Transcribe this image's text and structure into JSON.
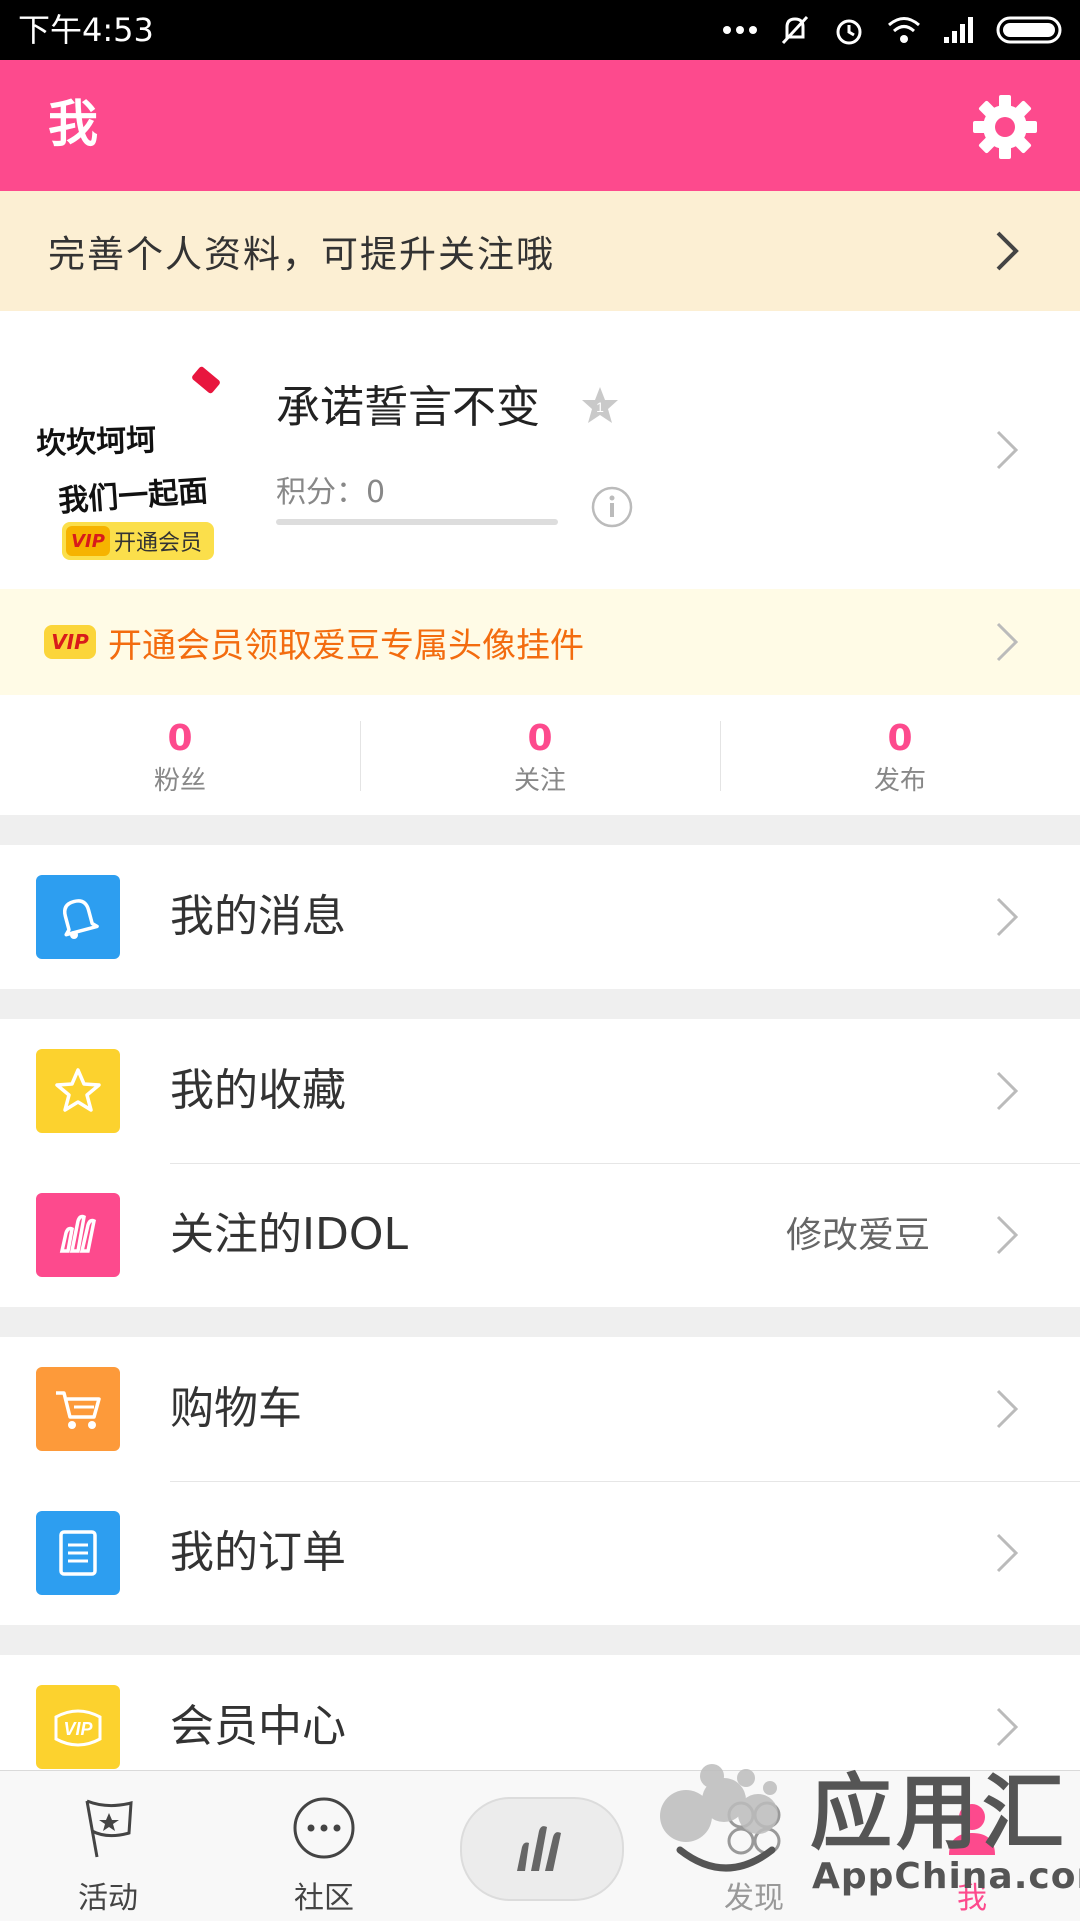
{
  "status_bar": {
    "time": "下午4:53"
  },
  "app_bar": {
    "title": "我"
  },
  "profile_prompt": {
    "text": "完善个人资料，可提升关注哦"
  },
  "profile": {
    "avatar_text_line1": "坎坎坷坷",
    "avatar_text_line2": "我们一起面",
    "vip_badge_mark": "VIP",
    "vip_badge_text": "开通会员",
    "username": "承诺誓言不变",
    "rank": "1",
    "points": "积分：0",
    "points_progress": 0
  },
  "vip_promo": {
    "mark": "VIP",
    "text": "开通会员领取爱豆专属头像挂件"
  },
  "stats": [
    {
      "value": "0",
      "label": "粉丝"
    },
    {
      "value": "0",
      "label": "关注"
    },
    {
      "value": "0",
      "label": "发布"
    }
  ],
  "menu": {
    "messages": {
      "label": "我的消息",
      "icon": "bell-icon",
      "color": "#2d9ef0"
    },
    "favorites": {
      "label": "我的收藏",
      "icon": "star-icon",
      "color": "#fcd22e"
    },
    "idol": {
      "label": "关注的IDOL",
      "extra": "修改爱豆",
      "icon": "idol-logo-icon",
      "color": "#fd4a8d"
    },
    "cart": {
      "label": "购物车",
      "icon": "cart-icon",
      "color": "#fd9a3a"
    },
    "orders": {
      "label": "我的订单",
      "icon": "document-icon",
      "color": "#2d9ef0"
    },
    "vip_center": {
      "label": "会员中心",
      "icon": "vip-icon",
      "color": "#fcd22e"
    }
  },
  "tabs": [
    {
      "label": "活动",
      "icon": "flag-icon"
    },
    {
      "label": "社区",
      "icon": "chat-dots-icon"
    },
    {
      "label": "",
      "icon": "idol-logo-icon"
    },
    {
      "label": "发现",
      "icon": "discover-icon"
    },
    {
      "label": "我",
      "icon": "person-icon"
    }
  ],
  "watermark": {
    "cn": "应用汇",
    "en": "AppChina.com"
  },
  "colors": {
    "accent": "#fd4a8d",
    "vip_orange": "#f36c0f"
  }
}
